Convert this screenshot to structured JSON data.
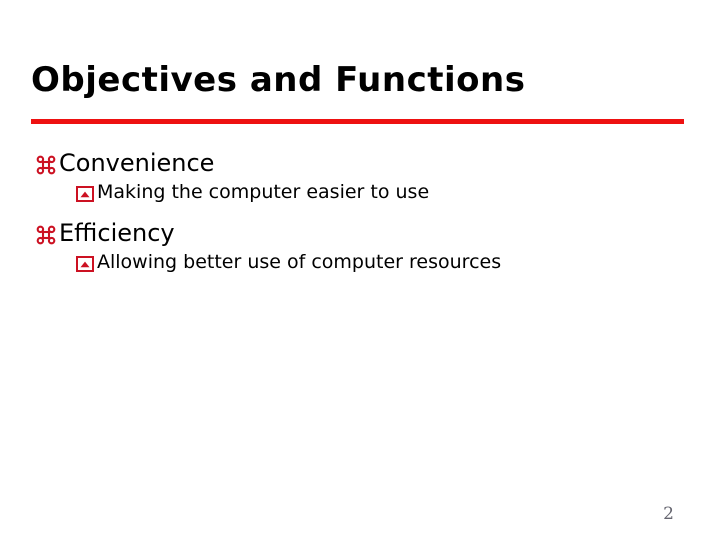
{
  "slide": {
    "title": "Objectives and Functions",
    "page_number": "2",
    "accent_rule_color": "#ee1111",
    "bullet_color": "#cc1122",
    "title_color": "#000000",
    "body_text_color": "#000000",
    "background_color": "#ffffff",
    "page_number_color": "#666670"
  },
  "bullets": [
    {
      "level": 1,
      "marker": "place-of-interest-bullet",
      "text": "Convenience"
    },
    {
      "level": 2,
      "marker": "boxed-chevron-bullet",
      "text": "Making the computer easier to use"
    },
    {
      "level": 1,
      "marker": "place-of-interest-bullet",
      "text": "Efficiency"
    },
    {
      "level": 2,
      "marker": "boxed-chevron-bullet",
      "text": "Allowing better use of computer resources"
    }
  ]
}
